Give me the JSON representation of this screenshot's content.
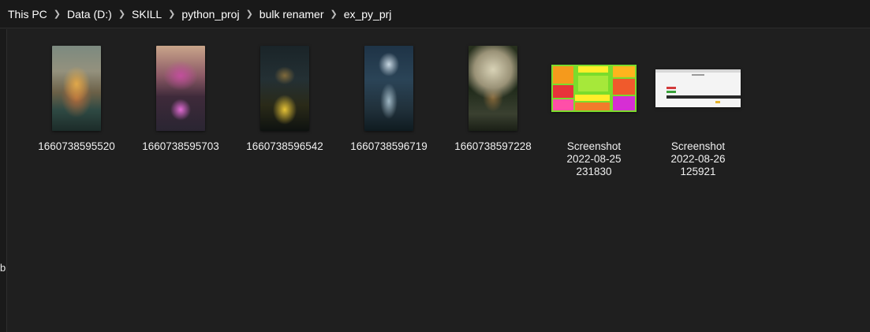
{
  "breadcrumb": [
    "This PC",
    "Data (D:)",
    "SKILL",
    "python_proj",
    "bulk renamer",
    "ex_py_prj"
  ],
  "left_pane_letter": "b",
  "files": [
    {
      "name": "1660738595520",
      "thumb": "temple-sunset-image"
    },
    {
      "name": "1660738595703",
      "thumb": "temple-lotus-image"
    },
    {
      "name": "1660738596542",
      "thumb": "temple-night-image"
    },
    {
      "name": "1660738596719",
      "thumb": "temple-waterfall-image"
    },
    {
      "name": "1660738597228",
      "thumb": "temple-moon-image"
    },
    {
      "name": "Screenshot\n2022-08-25\n231830",
      "thumb": "colorful-notes-screenshot"
    },
    {
      "name": "Screenshot\n2022-08-26\n125921",
      "thumb": "webpage-screenshot"
    }
  ],
  "colors": {
    "background": "#1f1f1f",
    "breadcrumb_bar": "#191919",
    "text": "#ffffff"
  }
}
